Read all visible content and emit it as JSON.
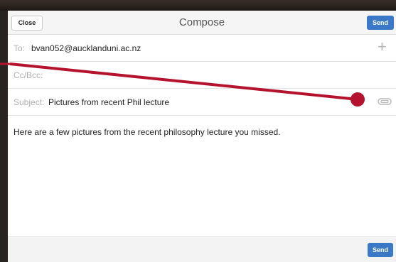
{
  "toolbar": {
    "close_label": "Close",
    "title": "Compose",
    "send_label": "Send"
  },
  "fields": {
    "to_label": "To:",
    "to_value": "bvan052@aucklanduni.ac.nz",
    "ccbcc_label": "Cc/Bcc:",
    "subject_label": "Subject:",
    "subject_value": "Pictures from recent Phil lecture"
  },
  "message": {
    "body": "Here are a few pictures from the recent philosophy lecture you missed."
  },
  "bottom": {
    "send_label": "Send"
  },
  "icons": {
    "add_recipient": "plus-icon",
    "attachment": "paperclip-icon"
  },
  "colors": {
    "accent": "#3b78c8",
    "annotation": "#b5122e"
  }
}
